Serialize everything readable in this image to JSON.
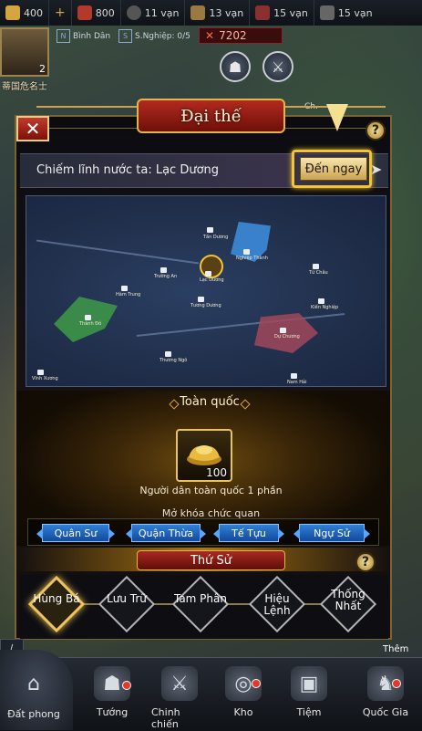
{
  "resources": [
    {
      "name": "gold",
      "value": "400",
      "color": "#d4a640"
    },
    {
      "name": "plus",
      "value": "+",
      "color": "#c08030"
    },
    {
      "name": "token",
      "value": "800",
      "color": "#b33a2a"
    },
    {
      "name": "food",
      "value": "11 vạn",
      "color": "#777"
    },
    {
      "name": "wood",
      "value": "13 vạn",
      "color": "#9a7a40"
    },
    {
      "name": "iron",
      "value": "15 vạn",
      "color": "#8a3030"
    },
    {
      "name": "stone",
      "value": "15 vạn",
      "color": "#777"
    }
  ],
  "player": {
    "level": "2",
    "name": "蒂国危名士",
    "rank_tag": "N",
    "rank_label": "Bình Dân",
    "career_tag": "S",
    "career_label": "S.Nghiệp: 0/5",
    "power": "7202"
  },
  "map_label_right": "Ch.",
  "panel": {
    "title": "Đại thế",
    "close": "✕",
    "help": "?",
    "occupy_text": "Chiếm lĩnh nước ta: Lạc Dương",
    "goto_label": "Đến ngay"
  },
  "map_cities": [
    {
      "name": "Tấn Dương"
    },
    {
      "name": "Nghiệp Thành"
    },
    {
      "name": "Lạc Dương"
    },
    {
      "name": "Trường An"
    },
    {
      "name": "Hàm Trung"
    },
    {
      "name": "Tứ Châu"
    },
    {
      "name": "Kiến Nghiệp"
    },
    {
      "name": "Thành Đô"
    },
    {
      "name": "Tương Dương"
    },
    {
      "name": "Dự Chương"
    },
    {
      "name": "Thương Ngô"
    },
    {
      "name": "Vĩnh Xương"
    },
    {
      "name": "Nam Hải"
    }
  ],
  "nation": {
    "label": "Toàn quốc",
    "item_qty": "100",
    "item_desc": "Người dân toàn quốc 1 phần",
    "unlock_label": "Mở khóa chức quan",
    "offices": [
      "Quân Sư",
      "Quận Thừa",
      "Tế Tựu",
      "Ngự Sử"
    ]
  },
  "thu_su": {
    "title": "Thứ Sử",
    "tiers": [
      "Hùng Bá",
      "Lưu Trữ",
      "Tam Phân",
      "Hiệu Lệnh",
      "Thống Nhất"
    ]
  },
  "side_label": "Thêm",
  "nav": [
    {
      "label": "Đất phong",
      "icon": "⌂"
    },
    {
      "label": "Tướng",
      "icon": "☗"
    },
    {
      "label": "Chinh chiến",
      "icon": "⚔"
    },
    {
      "label": "Kho",
      "icon": "◎"
    },
    {
      "label": "Tiệm",
      "icon": "▣"
    },
    {
      "label": "Quốc Gia",
      "icon": "♞"
    }
  ]
}
